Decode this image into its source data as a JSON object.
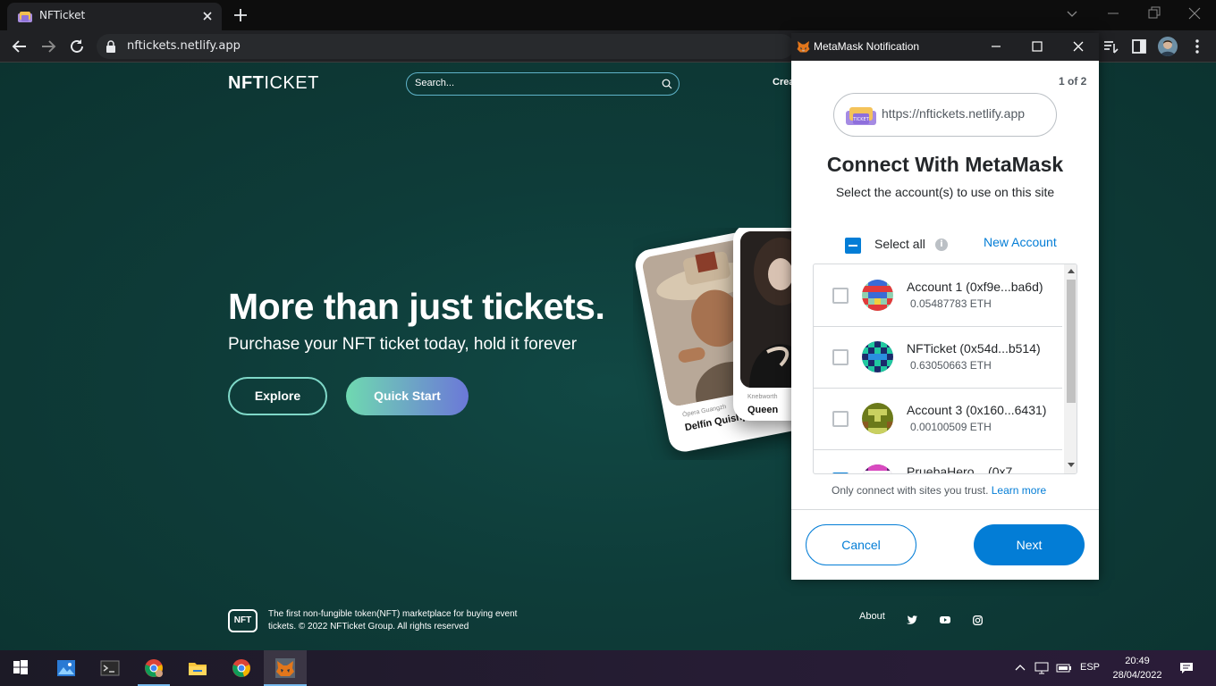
{
  "browser": {
    "tab_title": "NFTicket",
    "url": "nftickets.netlify.app"
  },
  "site": {
    "logo_bold": "NFT",
    "logo_rest": "ICKET",
    "search_placeholder": "Search...",
    "nav_create": "Crea",
    "hero_title": "More than just tickets.",
    "hero_subtitle": "Purchase your NFT ticket today, hold it forever",
    "explore_label": "Explore",
    "quick_start_label": "Quick Start",
    "cards": [
      {
        "venue": "Ópera Guangzh",
        "name": "Delfín Quishp"
      },
      {
        "venue": "Knebworth",
        "name": "Queen"
      }
    ],
    "footer": {
      "logo_text": "NFT",
      "text": "The first non-fungible token(NFT) marketplace for buying event tickets. © 2022 NFTicket Group. All rights reserved",
      "about": "About",
      "social_icons": [
        "twitter-icon",
        "youtube-icon",
        "instagram-icon"
      ]
    }
  },
  "metamask": {
    "window_title": "MetaMask Notification",
    "counter": "1 of 2",
    "origin": "https://nftickets.netlify.app",
    "heading": "Connect With MetaMask",
    "subheading": "Select the account(s) to use on this site",
    "select_all": "Select all",
    "new_account": "New Account",
    "accounts": [
      {
        "name": "Account 1 (0xf9e...ba6d)",
        "balance": "0.05487783 ETH",
        "checked": false
      },
      {
        "name": "NFTicket (0x54d...b514)",
        "balance": "0.63050663 ETH",
        "checked": false
      },
      {
        "name": "Account 3 (0x160...6431)",
        "balance": "0.00100509 ETH",
        "checked": false
      },
      {
        "name": "PruebaHero... (0x7",
        "balance": "",
        "checked": true
      }
    ],
    "trust_text": "Only connect with sites you trust.",
    "learn_more": "Learn more",
    "cancel_label": "Cancel",
    "next_label": "Next",
    "accent_color": "#037dd6"
  },
  "taskbar": {
    "apps": [
      "windows-start-icon",
      "photos-icon",
      "terminal-icon",
      "chrome-icon",
      "file-explorer-icon",
      "chrome-icon",
      "metamask-icon"
    ],
    "language": "ESP",
    "time": "20:49",
    "date": "28/04/2022"
  }
}
